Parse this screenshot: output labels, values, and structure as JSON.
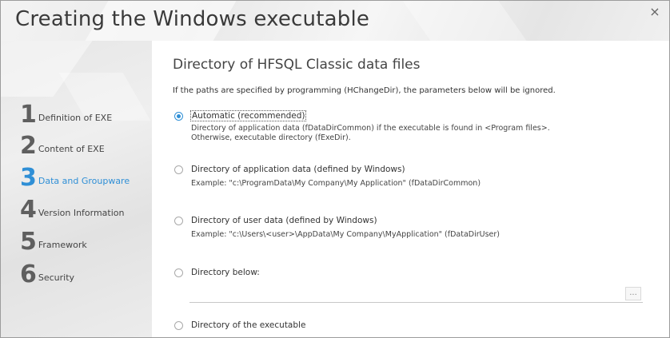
{
  "window": {
    "title": "Creating the Windows executable",
    "close_glyph": "×"
  },
  "sidebar": {
    "steps": [
      {
        "number": "1",
        "label": "Definition of EXE",
        "active": false
      },
      {
        "number": "2",
        "label": "Content of EXE",
        "active": false
      },
      {
        "number": "3",
        "label": "Data and Groupware",
        "active": true
      },
      {
        "number": "4",
        "label": "Version Information",
        "active": false
      },
      {
        "number": "5",
        "label": "Framework",
        "active": false
      },
      {
        "number": "6",
        "label": "Security",
        "active": false
      }
    ]
  },
  "main": {
    "heading": "Directory of HFSQL Classic data files",
    "subtitle": "If the paths are specified by programming (HChangeDir), the parameters below will be ignored.",
    "options": [
      {
        "label": "Automatic (recommended)",
        "checked": true,
        "desc1": "Directory of application data (fDataDirCommon) if the executable is found in <Program files>.",
        "desc2": "Otherwise, executable directory (fExeDir)."
      },
      {
        "label": "Directory of application data (defined by Windows)",
        "checked": false,
        "desc1": "Example: \"c:\\ProgramData\\My Company\\My Application\" (fDataDirCommon)"
      },
      {
        "label": "Directory of user data (defined by Windows)",
        "checked": false,
        "desc1": "Example: \"c:\\Users\\<user>\\AppData\\My Company\\MyApplication\" (fDataDirUser)"
      },
      {
        "label": "Directory below:",
        "checked": false
      },
      {
        "label": "Directory of the executable",
        "checked": false
      }
    ],
    "directory_value": "",
    "browse_label": "..."
  },
  "colors": {
    "accent": "#2f8fd6",
    "sidebar_bg": "#e9e9e9"
  },
  "icons": {
    "close": "close-icon",
    "radio_checked": "radio-checked",
    "radio_unchecked": "radio-unchecked"
  }
}
